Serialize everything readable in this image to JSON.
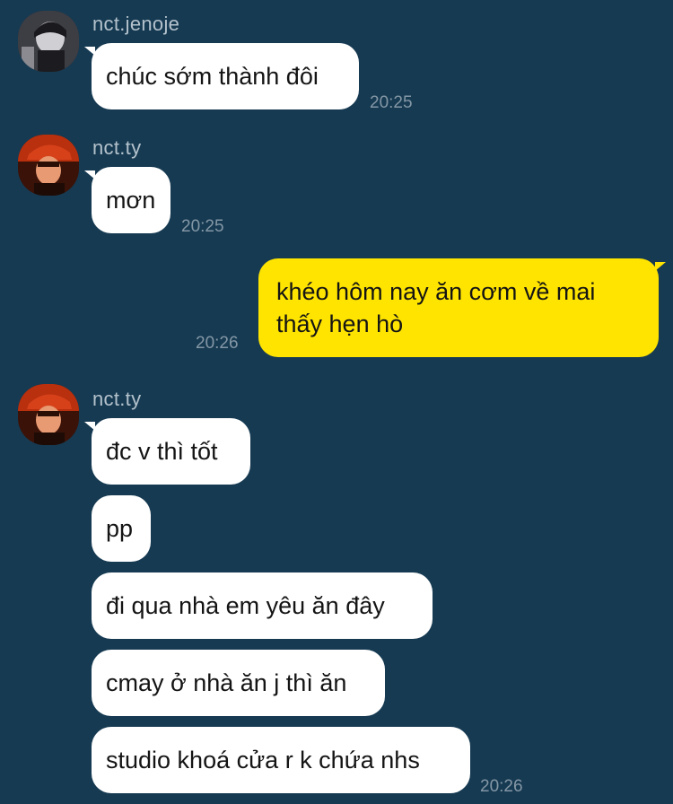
{
  "messages": [
    {
      "sender": "nct.jenoje",
      "avatar": "jenoje-avatar",
      "text": "chúc sớm thành đôi",
      "time": "20:25"
    },
    {
      "sender": "nct.ty",
      "avatar": "ty-avatar",
      "text": "mơn",
      "time": "20:25"
    },
    {
      "sender": "me",
      "text": "khéo hôm nay ăn cơm về mai thấy hẹn hò",
      "time": "20:26"
    },
    {
      "sender": "nct.ty",
      "avatar": "ty-avatar",
      "lines": [
        "đc v thì tốt",
        "pp",
        "đi qua nhà em yêu ăn đây",
        "cmay ở nhà ăn j thì ăn",
        "studio khoá cửa r k chứa nhs"
      ],
      "time": "20:26"
    }
  ],
  "colors": {
    "background": "#163a52",
    "incoming_bubble": "#ffffff",
    "outgoing_bubble": "#ffe400",
    "timestamp": "#8497a5",
    "username": "#b4c2cc"
  }
}
